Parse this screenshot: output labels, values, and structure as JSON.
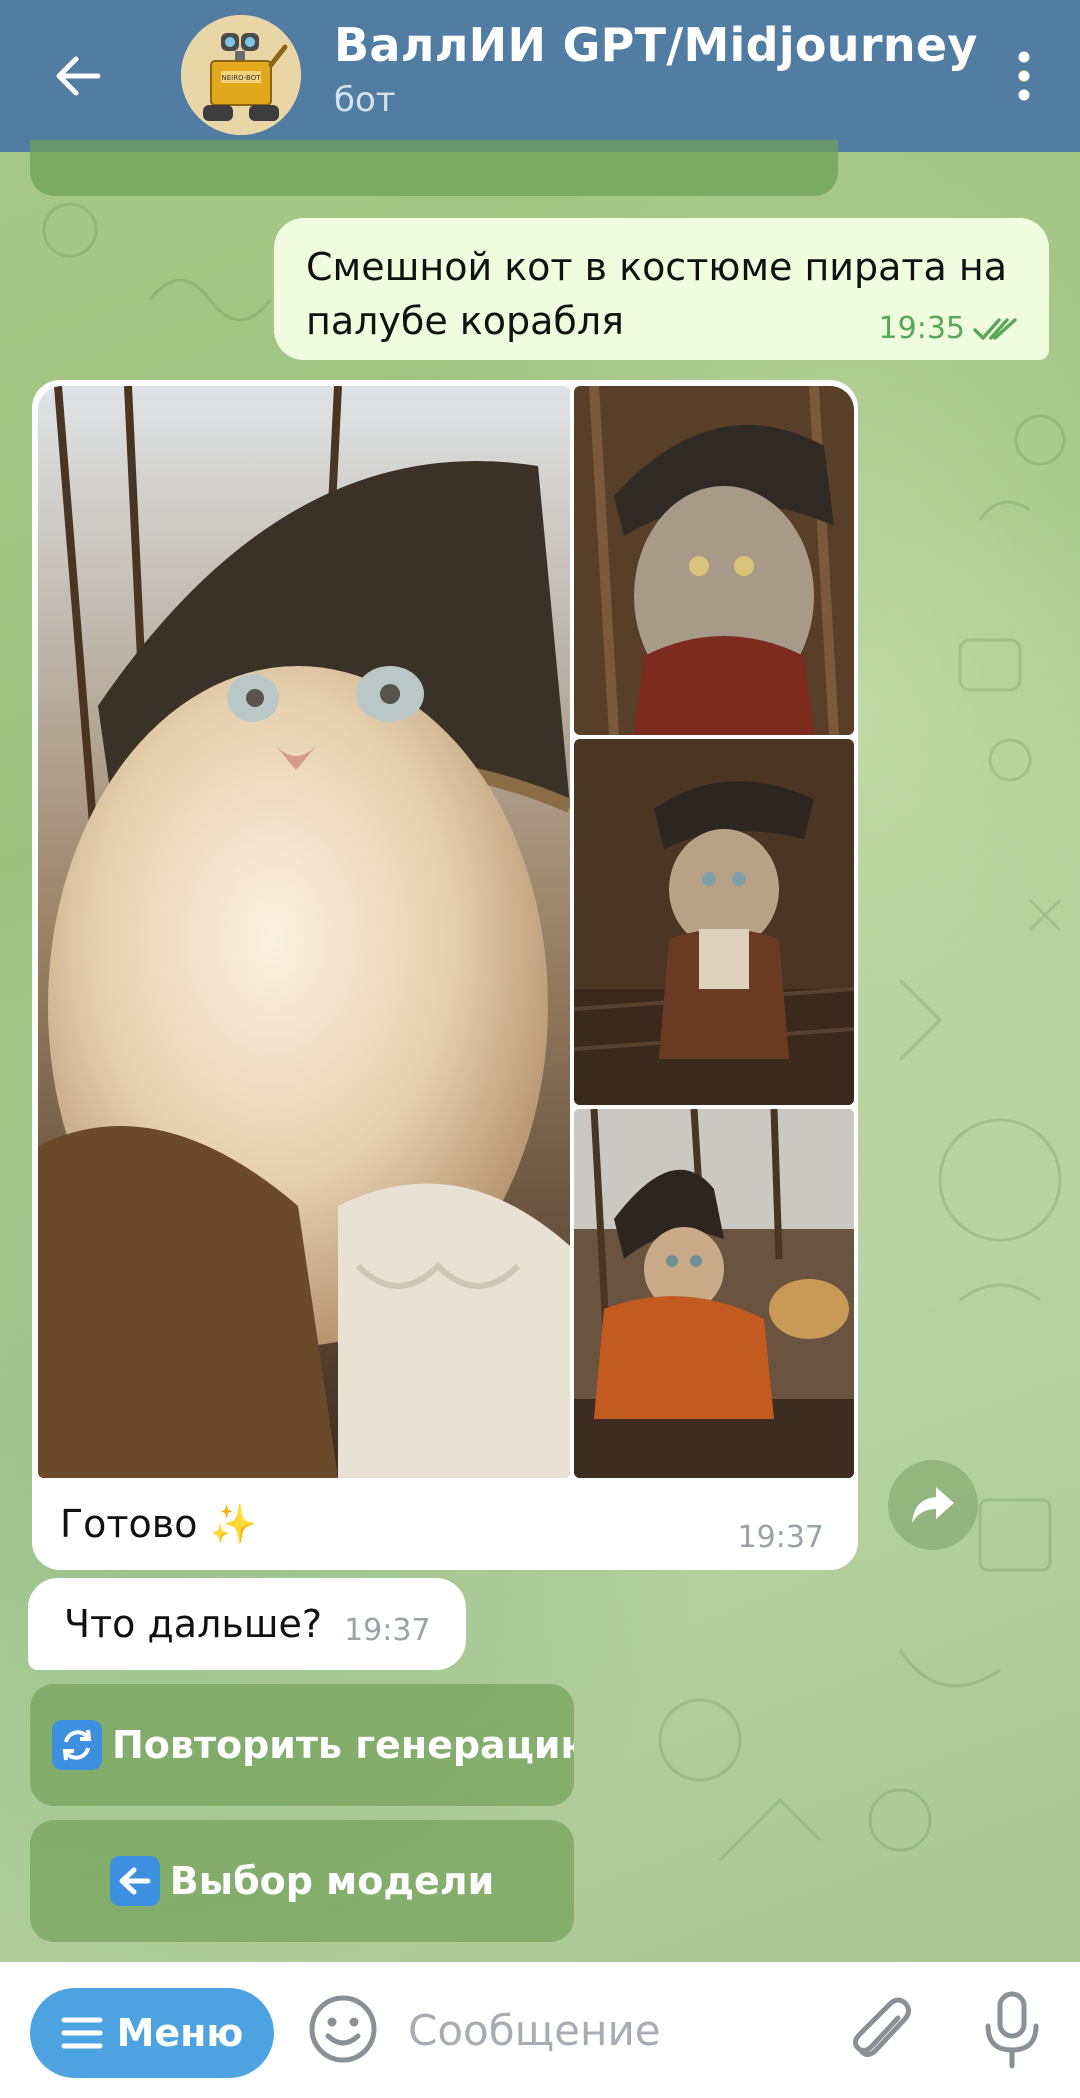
{
  "header": {
    "title": "ВаллИИ GPT/Midjourney",
    "subtitle": "бот",
    "avatar_text": "NEIRO-BOT"
  },
  "messages": {
    "outgoing": {
      "text": "Смешной кот в костюме пирата на палубе корабля",
      "time": "19:35",
      "status": "read"
    },
    "media": {
      "caption": "Готово ✨",
      "time": "19:37",
      "image_count": 4
    },
    "incoming": {
      "text": "Что дальше?",
      "time": "19:37"
    }
  },
  "keyboard": {
    "buttons": [
      {
        "emoji": "🔄",
        "label": "Повторить генерацию"
      },
      {
        "emoji": "⬅️",
        "label": "Выбор модели"
      }
    ]
  },
  "input_bar": {
    "menu_label": "Меню",
    "placeholder": "Сообщение"
  },
  "colors": {
    "header": "#517da2",
    "outgoing_bubble": "#effdde",
    "accent": "#4da3e0",
    "read_ticks": "#5aa65a"
  },
  "icons": [
    "back-arrow-icon",
    "more-vertical-icon",
    "double-check-icon",
    "forward-icon",
    "hamburger-icon",
    "smile-icon",
    "paperclip-icon",
    "mic-icon",
    "refresh-icon",
    "left-arrow-icon"
  ]
}
